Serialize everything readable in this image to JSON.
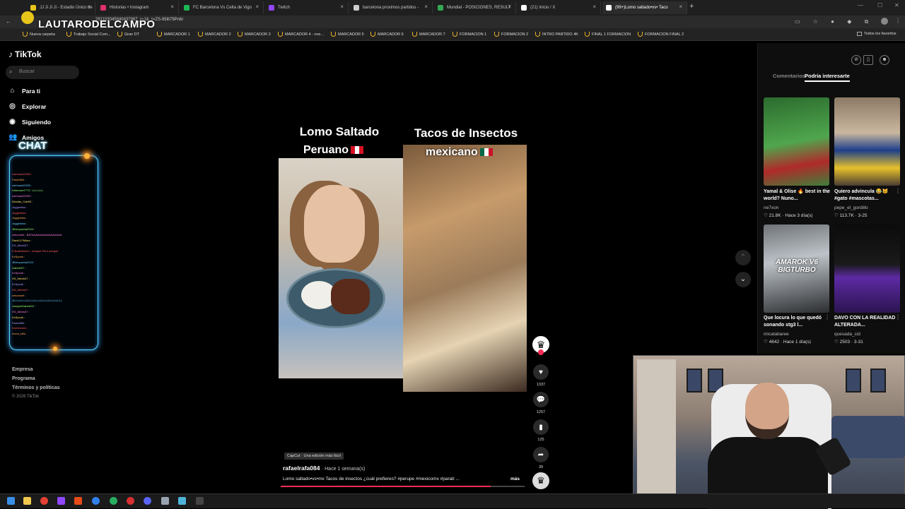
{
  "browser": {
    "tabs": [
      {
        "label": "JJ Ji Ji Ji - Estadio Único de",
        "color": "#e8c51a"
      },
      {
        "label": "Historias • Instagram",
        "color": "#e1306c"
      },
      {
        "label": "FC Barcelona Vs Celta de Vigo",
        "color": "#1db954"
      },
      {
        "label": "Twitch",
        "color": "#9146ff"
      },
      {
        "label": "barcelona proximos partidos -",
        "color": "#cccccc"
      },
      {
        "label": "Mundial - POSICIONES, RESULT",
        "color": "#34a853"
      },
      {
        "label": "(21) Inicio / X",
        "color": "#ffffff"
      },
      {
        "label": "(99+)Lomo saltado•vs• Taco",
        "color": "#ffffff"
      }
    ],
    "url": "...291103045840437967_r=1&_t=ZS-95llt79Pn6r",
    "overlay_name": "LAUTARODELCAMPO",
    "bookmarks": [
      "Nueva carpeta",
      "Trabajo Social Com...",
      "Gran DT",
      "MARCADOR 1",
      "MARCADOR 2",
      "MARCADOR 3",
      "MARCADOR 4 - ove...",
      "MARCADOR 5",
      "MARCADOR 6",
      "MARCADOR 7",
      "FORMACION 1",
      "FORMACION 2",
      "INTRO PARTIDO 4K",
      "FINAL 1 FORMACION",
      "FORMACION FINAL 2"
    ],
    "all_bookmarks": "Todos los favoritos"
  },
  "tiktok": {
    "logo": "TikTok",
    "search_placeholder": "Buscar",
    "nav": [
      "Para ti",
      "Explorar",
      "Siguiendo",
      "Amigos"
    ],
    "footer": [
      "Empresa",
      "Programa",
      "Términos y políticas",
      "© 2026 TikTok"
    ]
  },
  "chat": {
    "label": "CHAT",
    "lines": [
      "carlosas23393 :",
      "Pame864 :",
      "carlosas23393 :",
      "Unknown7772 : LLLLLLL",
      "carlosas23393 :",
      "Nicolas_Cab93 :",
      "Juggerkiss :",
      "Juggerkiss :",
      "Juggerkiss :",
      "Juggerkiss :",
      "JBrevpacha2024 :",
      "cekoroset : BATAAAAAAAAAAAAAAAA",
      "DachCr7Mdss :",
      "H3_Alexis07 :",
      "FrikulsNeuton : eduque Perú eduque",
      "KxSpook :",
      "JBrevpacha2024 :",
      "Gabriel27 :",
      "KxSpook :",
      "H3_Alexis07 :",
      "KxSpook :",
      "H3_Alexis07 :",
      "cekoroset :",
      "JLLLLLLLLLLLLLLLLLLLLLLLLLLLLLLL",
      "JoaquinGabriel12 :",
      "H3_Alexis07 :",
      "KxSpook :",
      "Pame864 :",
      "Dominiorex :",
      "mono_kills :"
    ]
  },
  "video": {
    "title_left": "Lomo Saltado",
    "sub_left": "Peruano",
    "title_right": "Tacos de Insectos",
    "sub_right": "mexicano",
    "likes": "1337",
    "comments": "1257",
    "saves": "125",
    "shares": "39",
    "capcut": "CapCut · Una edición más fácil",
    "author": "rafaelrafa084",
    "ago": "· Hace 1 semana(s)",
    "caption": "Lomo saltado•vs•mx Tacos de insectos ¿cuál prefieres? #perupe #mexicomx #parati ...",
    "more": "más",
    "progress": 0.86
  },
  "right_panel": {
    "tab_comments": "Comentarios",
    "tab_interest": "Podría interesarte",
    "cards": [
      {
        "title": "Yamal & Olise 🔥 best in the world? Nuno...",
        "author": "ne7xon",
        "stats": "♡ 21.8K · Hace 3 día(s)"
      },
      {
        "title": "Quiero advincula 😂🐱 #gato #mascotas...",
        "author": "pepe_el_gordillo",
        "stats": "♡ 113.7K · 3-25"
      },
      {
        "title": "Que locura lo que quedó sonando stg3 l...",
        "author": "micatabaree",
        "stats": "♡ 4642 · Hace 1 día(s)"
      },
      {
        "title": "DAVO CON LA REALIDAD ALTERADA...",
        "author": "quesada_cid",
        "stats": "♡ 2503 · 3-31"
      }
    ],
    "card_overlay": "AMAROK V6 BIGTURBO"
  }
}
